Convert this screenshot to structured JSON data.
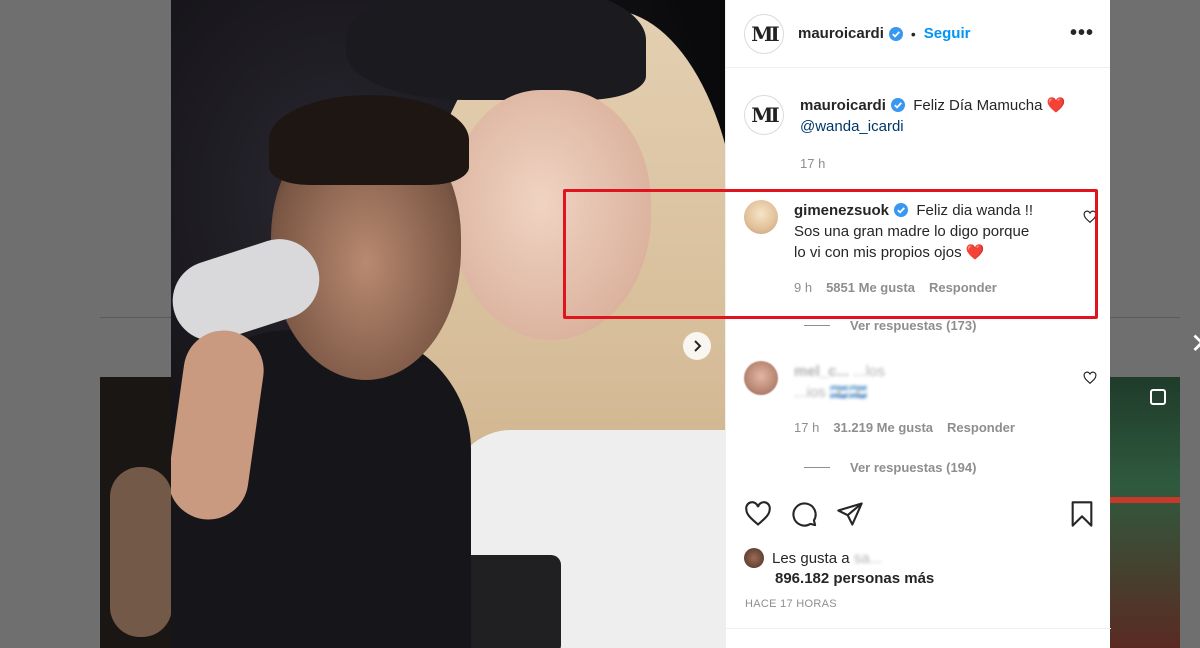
{
  "post": {
    "username": "mauroicardi",
    "follow_label": "Seguir",
    "dot": "•",
    "more_label": "•••",
    "avatar_monogram": "MI",
    "caption_text": "Feliz Día Mamucha",
    "caption_heart": "❤️",
    "caption_mention": "@wanda_icardi",
    "caption_time": "17 h"
  },
  "comments": [
    {
      "username": "gimenezsuok",
      "text_line1": "Feliz dia wanda !!",
      "text_line2": "Sos una gran madre lo digo porque",
      "text_line3": "lo vi con mis propios ojos",
      "heart": "❤️",
      "time": "9 h",
      "likes": "5851 Me gusta",
      "reply": "Responder",
      "view_replies": "Ver respuestas (173)"
    },
    {
      "username": "mel_c...",
      "text_line1": "...los",
      "text_line2": "...ios 🇦🇷🇦🇷",
      "time": "17 h",
      "likes": "31.219 Me gusta",
      "reply": "Responder",
      "view_replies": "Ver respuestas (194)"
    }
  ],
  "likes": {
    "prefix": "Les gusta a",
    "liker": "sa...",
    "count": "896.182 personas más"
  },
  "time_ago": "HACE 17 HORAS",
  "colors": {
    "accent": "#0095f6",
    "highlight": "#e0141f",
    "verified": "#3897f0"
  }
}
